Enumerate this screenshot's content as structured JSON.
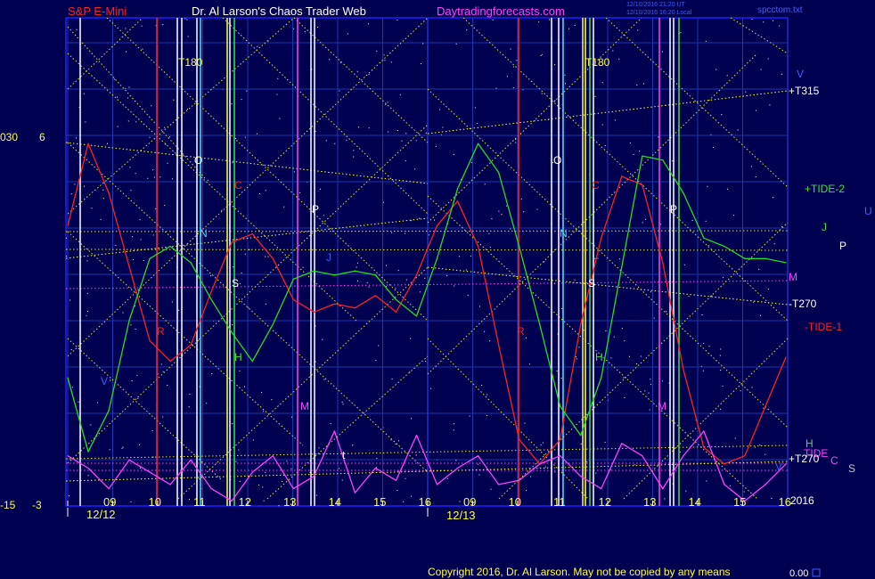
{
  "header": {
    "symbol": "S&P E-Mini",
    "publisher": "Dr. Al Larson's Chaos Trader Web",
    "site": "Daytradingforecasts.com",
    "stamp1": "12/10/2016 21:20 UT",
    "stamp2": "12/10/2016 16:20 Local",
    "file": "spcctom.txt"
  },
  "footer": {
    "copyright": "Copyright 2016, Dr. Al Larson. May not be copied by any means",
    "counter": "0.00"
  },
  "colors": {
    "background": "#000050",
    "frame": "#2020ff",
    "red_line": "#ff2020",
    "green_line": "#20e020",
    "magenta_line": "#ff40ff",
    "yellow_dotted": "#ffff40"
  },
  "chart_data": {
    "type": "line",
    "x_axis": {
      "day1": {
        "date": "12/12",
        "hours": [
          "09",
          "10",
          "11",
          "12",
          "13",
          "14",
          "15",
          "16"
        ]
      },
      "day2": {
        "date": "12/13",
        "hours": [
          "09",
          "10",
          "11",
          "12",
          "13",
          "14",
          "15",
          "16"
        ]
      }
    },
    "left_labels": [
      {
        "text": "030",
        "value": 6
      },
      {
        "text": "6",
        "value": 6
      },
      {
        "text": "-15",
        "value": -3
      },
      {
        "text": "-3",
        "value": -3
      }
    ],
    "ylim": [
      -3,
      6
    ],
    "right_labels": [
      "V",
      "+T315",
      "+TIDE-2",
      "J",
      "P",
      "U",
      "M",
      "-T270",
      "-TIDE-1",
      "H",
      "TIDE",
      "+T270",
      "C",
      "S",
      "V",
      "2016"
    ],
    "annotations": {
      "day1": [
        "T180",
        "O",
        "C",
        "N",
        "S",
        "P",
        "R",
        "H",
        "V",
        "M",
        "t",
        "J"
      ],
      "day2": [
        "T180",
        "O",
        "C",
        "N",
        "S",
        "P",
        "R",
        "H",
        "M"
      ]
    },
    "series": [
      {
        "color": "#ff2020",
        "x": [
          0,
          0.5,
          1,
          1.5,
          2,
          2.5,
          3,
          3.5,
          4,
          4.5,
          5,
          5.5,
          6,
          6.5,
          7,
          7.5,
          8,
          8.5,
          9,
          9.5,
          10,
          10.5,
          11,
          11.5,
          12,
          12.5,
          13,
          13.5,
          14,
          14.5,
          15,
          15.5,
          16,
          16.5,
          17,
          17.5
        ],
        "y": [
          3.8,
          5.8,
          4.6,
          2.8,
          1.0,
          0.5,
          0.9,
          2.2,
          3.4,
          3.6,
          3.0,
          2.0,
          1.7,
          1.9,
          1.8,
          2.1,
          1.7,
          2.6,
          3.8,
          4.4,
          3.3,
          0.9,
          -1.4,
          -2.0,
          -1.4,
          1.4,
          3.5,
          5.0,
          4.8,
          2.9,
          0.3,
          -1.6,
          -2.0,
          -1.8,
          -0.6,
          0.6
        ]
      },
      {
        "color": "#20e020",
        "x": [
          0,
          0.5,
          1,
          1.5,
          2,
          2.5,
          3,
          3.5,
          4,
          4.5,
          5,
          5.5,
          6,
          6.5,
          7,
          7.5,
          8,
          8.5,
          9,
          9.5,
          10,
          10.5,
          11,
          11.5,
          12,
          12.5,
          13,
          13.5,
          14,
          14.5,
          15,
          15.5,
          16,
          16.5,
          17,
          17.5
        ],
        "y": [
          0.1,
          -1.7,
          -0.7,
          1.5,
          3.0,
          3.3,
          2.9,
          2.0,
          1.2,
          0.5,
          1.4,
          2.5,
          2.7,
          2.6,
          2.7,
          2.6,
          2.0,
          1.6,
          3.0,
          4.7,
          5.8,
          5.1,
          3.3,
          1.4,
          -0.6,
          -1.3,
          0.1,
          2.8,
          5.5,
          5.4,
          4.6,
          3.5,
          3.3,
          3.0,
          3.0,
          2.9
        ]
      },
      {
        "color": "#ff40ff",
        "x": [
          0,
          0.5,
          1,
          1.5,
          2,
          2.5,
          3,
          3.5,
          4,
          4.5,
          5,
          5.5,
          6,
          6.5,
          7,
          7.5,
          8,
          8.5,
          9,
          9.5,
          10,
          10.5,
          11,
          11.5,
          12,
          12.5,
          13,
          13.5,
          14,
          14.5,
          15,
          15.5,
          16,
          16.5,
          17,
          17.5
        ],
        "y": [
          -1.8,
          -2.1,
          -2.6,
          -1.9,
          -2.2,
          -2.5,
          -1.9,
          -2.6,
          -2.9,
          -2.2,
          -1.8,
          -2.6,
          -2.3,
          -1.2,
          -2.7,
          -2.1,
          -2.4,
          -1.3,
          -2.5,
          -2.1,
          -1.8,
          -2.5,
          -2.4,
          -2.0,
          -1.8,
          -2.3,
          -2.6,
          -1.5,
          -1.8,
          -2.6,
          -1.8,
          -1.2,
          -2.5,
          -2.9,
          -2.5,
          -2.0
        ]
      }
    ]
  }
}
